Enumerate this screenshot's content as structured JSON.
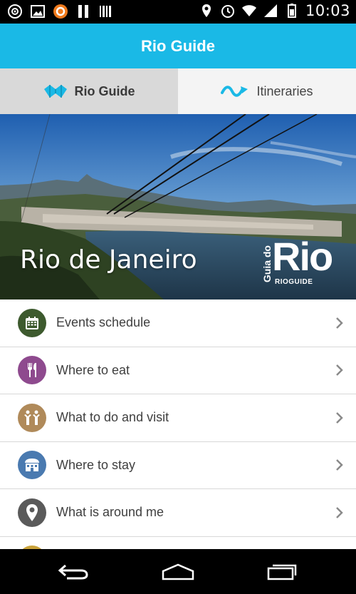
{
  "status_bar": {
    "time": "10:03",
    "left_icons": [
      "target-icon",
      "image-icon",
      "avast-icon",
      "pause-icon",
      "barcode-icon"
    ],
    "right_icons": [
      "location-icon",
      "alarm-icon",
      "wifi-icon",
      "signal-icon",
      "battery-icon"
    ]
  },
  "app_bar": {
    "title": "Rio Guide",
    "color": "#1ab9e6"
  },
  "tabs": [
    {
      "label": "Rio Guide",
      "icon": "map-icon",
      "active": true
    },
    {
      "label": "Itineraries",
      "icon": "route-icon",
      "active": false
    }
  ],
  "hero": {
    "city": "Rio de Janeiro",
    "logo": {
      "vertical": "Guia do",
      "main": "Rio",
      "sub": "RIOGUIDE"
    }
  },
  "menu": {
    "items": [
      {
        "label": "Events schedule",
        "icon": "calendar-icon",
        "color": "#3d5a2e"
      },
      {
        "label": "Where to eat",
        "icon": "cutlery-icon",
        "color": "#8e4a8e"
      },
      {
        "label": "What to do and visit",
        "icon": "people-icon",
        "color": "#b08a5a"
      },
      {
        "label": "Where to stay",
        "icon": "hotel-icon",
        "color": "#4a7ab0"
      },
      {
        "label": "What is around me",
        "icon": "pin-icon",
        "color": "#5a5a5a"
      },
      {
        "label": "",
        "icon": "partial-icon",
        "color": "#c9a23a"
      }
    ]
  },
  "nav_bar": {
    "buttons": [
      "back-icon",
      "home-icon",
      "recents-icon"
    ]
  }
}
